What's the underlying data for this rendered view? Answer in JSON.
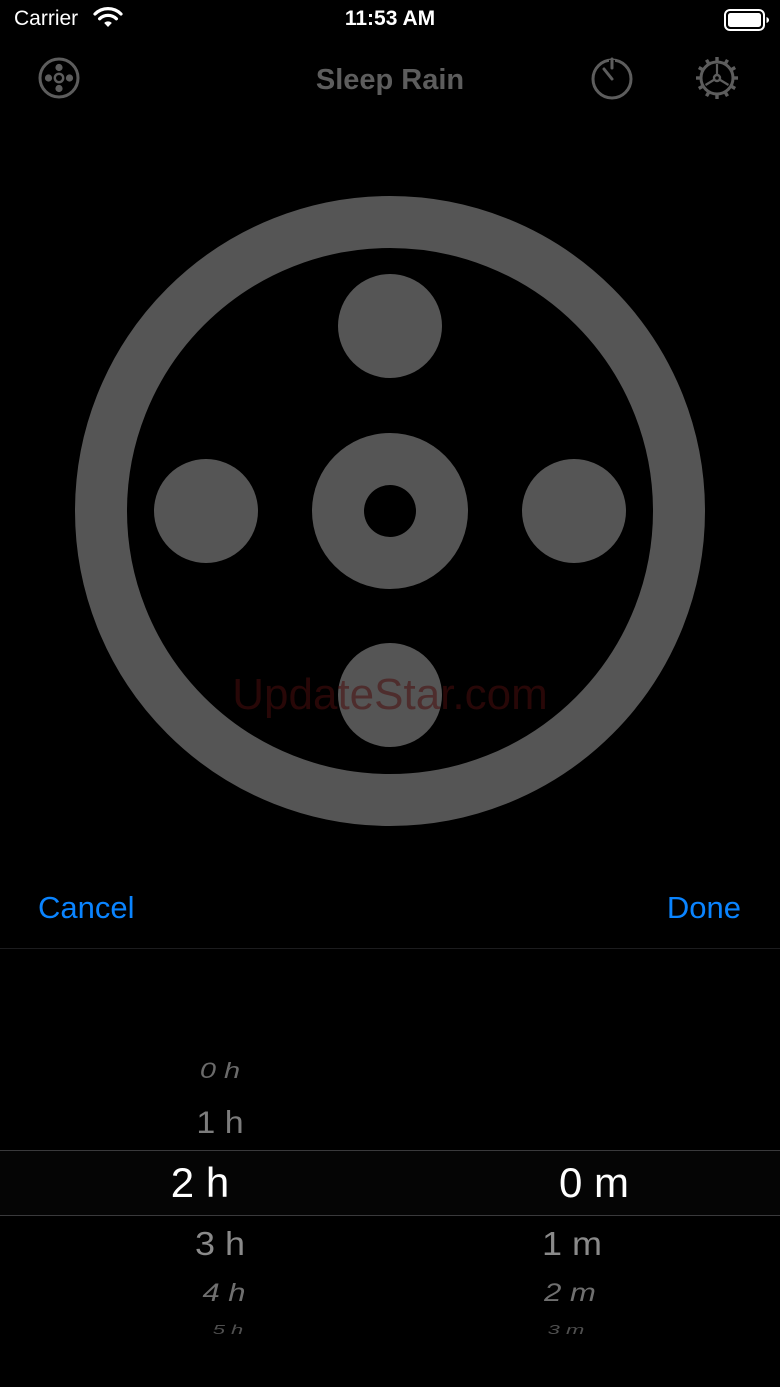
{
  "status_bar": {
    "carrier": "Carrier",
    "time": "11:53 AM"
  },
  "nav": {
    "title": "Sleep Rain",
    "left_icon": "reel-icon",
    "right_icons": [
      "timer-icon",
      "settings-gear-icon"
    ]
  },
  "hero": {
    "icon": "reel-icon",
    "color": "#555555"
  },
  "watermark": "UpdateStar.com",
  "toolbar": {
    "cancel_label": "Cancel",
    "done_label": "Done",
    "accent": "#0a84ff"
  },
  "picker": {
    "hours": {
      "above": [
        "0 h",
        "1 h"
      ],
      "selected": "2 h",
      "below": [
        "3 h",
        "4 h",
        "5 h"
      ]
    },
    "minutes": {
      "above": [],
      "selected": "0 m",
      "below": [
        "1 m",
        "2 m",
        "3 m"
      ]
    }
  }
}
